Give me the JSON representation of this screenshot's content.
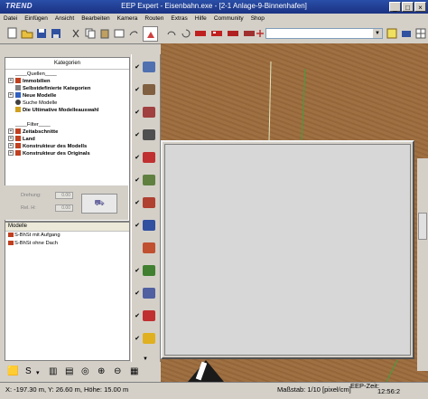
{
  "window": {
    "logo_text": "TREND",
    "title": "EEP Expert - Eisenbahn.exe - [2-1 Anlage-9-Binnenhafen]",
    "minimize": "_",
    "maximize": "□",
    "close": "×"
  },
  "menu": [
    "Datei",
    "Einfügen",
    "Ansicht",
    "Bearbeiten",
    "Kamera",
    "Routen",
    "Extras",
    "Hilfe",
    "Community",
    "Shop"
  ],
  "catalog": {
    "header": "Kategorien",
    "tree": [
      {
        "label": "____Quellen____",
        "bold": false,
        "expander": ""
      },
      {
        "label": "Immobilien",
        "bold": true,
        "expander": "+"
      },
      {
        "label": "Selbstdefinierte Kategorien",
        "bold": true,
        "expander": ""
      },
      {
        "label": "Neue Modelle",
        "bold": true,
        "expander": "+"
      },
      {
        "label": "Suche Modelle",
        "bold": false,
        "expander": ""
      },
      {
        "label": "Die Ultimative Modelleauswahl",
        "bold": true,
        "expander": ""
      },
      {
        "label": "",
        "bold": false,
        "expander": ""
      },
      {
        "label": "____Filter____",
        "bold": false,
        "expander": ""
      },
      {
        "label": "Zeitabschnitte",
        "bold": true,
        "expander": "+"
      },
      {
        "label": "Land",
        "bold": true,
        "expander": "+"
      },
      {
        "label": "Konstrukteur des Modells",
        "bold": true,
        "expander": "+"
      },
      {
        "label": "Konstrukteur des Originals",
        "bold": true,
        "expander": "+"
      }
    ]
  },
  "rotation": {
    "drehung_label": "Drehung:",
    "drehung_value": "0.00",
    "relh_label": "Rel. H:",
    "relh_value": "0.00"
  },
  "models": {
    "header": "Modelle",
    "items": [
      "S-BhSt mit Aufgang",
      "S-BhSt ohne Dach"
    ]
  },
  "status": {
    "position": "X: -197.30 m, Y: 26.60 m, Höhe: 15.00 m",
    "scale": "Maßstab: 1/10 [pixel/cm]",
    "eep_time_label": "EEP-Zeit:",
    "eep_time_value": "12:56:2"
  },
  "colors": {
    "titlebar": "#1a3282",
    "ground": "#9c6b3c",
    "panel": "#d4d0c8"
  }
}
